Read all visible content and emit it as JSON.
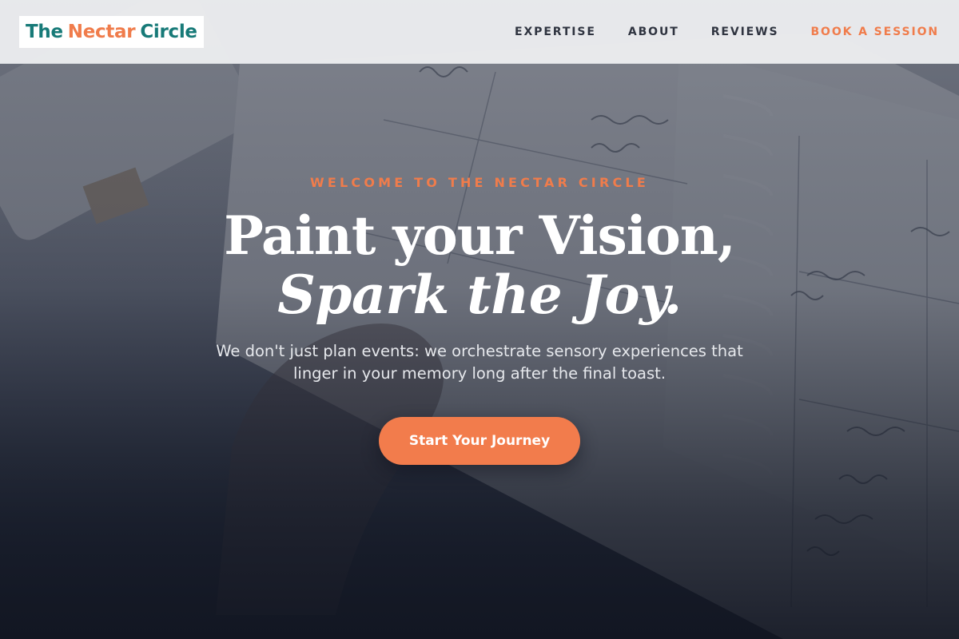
{
  "brand": {
    "logo_word_1": "The",
    "logo_word_2": "Nectar",
    "logo_word_3": "Circle",
    "colors": {
      "teal": "#177a78",
      "orange": "#f07c4b"
    }
  },
  "nav": {
    "items": [
      {
        "label": "EXPERTISE"
      },
      {
        "label": "ABOUT"
      },
      {
        "label": "REVIEWS"
      },
      {
        "label": "BOOK A SESSION"
      }
    ]
  },
  "hero": {
    "eyebrow": "WELCOME TO THE NECTAR CIRCLE",
    "headline_line_1": "Paint your Vision,",
    "headline_line_2": "Spark the Joy.",
    "subtitle": "We don't just plan events: we orchestrate sensory experiences that linger in your memory long after the final toast.",
    "cta_label": "Start Your Journey",
    "background_image": "planner-notebook-photo"
  }
}
